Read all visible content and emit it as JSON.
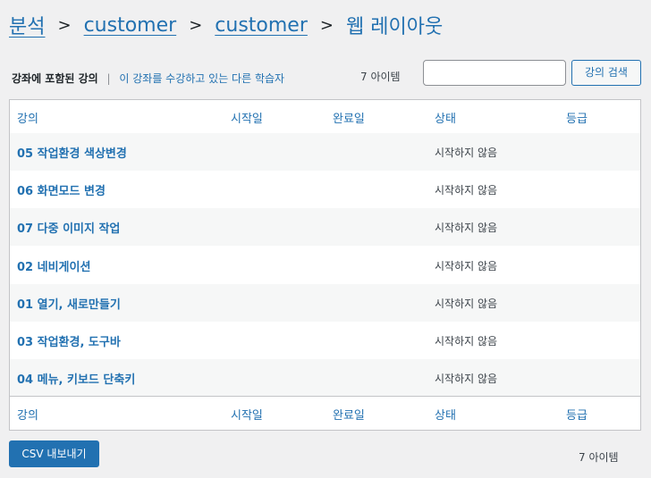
{
  "breadcrumb": {
    "items": [
      "분석",
      "customer",
      "customer"
    ],
    "current": "웹 레이아웃",
    "separator": ">"
  },
  "subnav": {
    "active": "강좌에 포함된 강의",
    "separator": "|",
    "link": "이 강좌를 수강하고 있는 다른 학습자"
  },
  "top_count": "7 아이템",
  "search": {
    "value": "",
    "button_label": "강의 검색"
  },
  "table": {
    "columns": [
      "강의",
      "시작일",
      "완료일",
      "상태",
      "등급"
    ],
    "rows": [
      {
        "course": "05 작업환경 색상변경",
        "start": "",
        "end": "",
        "status": "시작하지 않음",
        "grade": ""
      },
      {
        "course": "06 화면모드 변경",
        "start": "",
        "end": "",
        "status": "시작하지 않음",
        "grade": ""
      },
      {
        "course": "07 다중 이미지 작업",
        "start": "",
        "end": "",
        "status": "시작하지 않음",
        "grade": ""
      },
      {
        "course": "02 네비게이션",
        "start": "",
        "end": "",
        "status": "시작하지 않음",
        "grade": ""
      },
      {
        "course": "01 열기, 새로만들기",
        "start": "",
        "end": "",
        "status": "시작하지 않음",
        "grade": ""
      },
      {
        "course": "03 작업환경, 도구바",
        "start": "",
        "end": "",
        "status": "시작하지 않음",
        "grade": ""
      },
      {
        "course": "04 메뉴, 키보드 단축키",
        "start": "",
        "end": "",
        "status": "시작하지 않음",
        "grade": ""
      }
    ]
  },
  "export_button": "CSV 내보내기",
  "bottom_count": "7 아이템",
  "colors": {
    "link": "#2271b1",
    "background": "#f0f0f1",
    "button_primary": "#2271b1"
  }
}
